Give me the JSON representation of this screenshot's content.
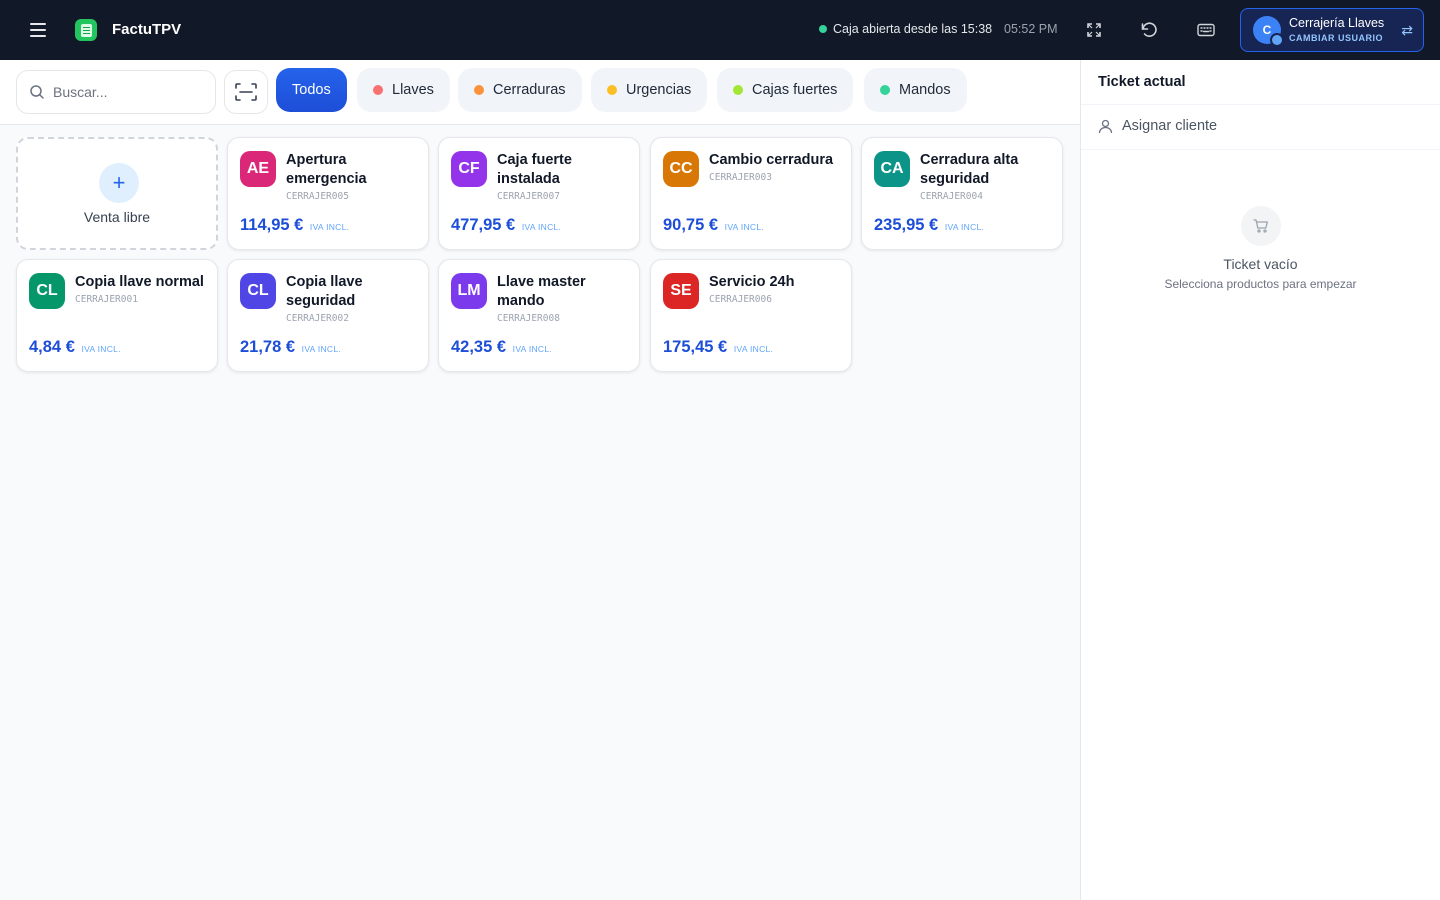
{
  "header": {
    "app_name": "FactuTPV",
    "status_text": "Caja abierta desde las 15:38",
    "time": "05:52 PM",
    "user": {
      "name": "Cerrajería Llaves",
      "avatar_initial": "C",
      "switch_label": "CAMBIAR USUARIO"
    },
    "icons": [
      "menu-icon",
      "logo-icon",
      "fullscreen-icon",
      "refresh-icon",
      "keyboard-icon",
      "swap-icon"
    ]
  },
  "search": {
    "placeholder": "Buscar..."
  },
  "categories": [
    {
      "label": "Todos",
      "active": true
    },
    {
      "label": "Llaves",
      "color": "#f87171"
    },
    {
      "label": "Cerraduras",
      "color": "#fb923c"
    },
    {
      "label": "Urgencias",
      "color": "#fbbf24"
    },
    {
      "label": "Cajas fuertes",
      "color": "#a3e635"
    },
    {
      "label": "Mandos",
      "color": "#34d399"
    }
  ],
  "free_sale": {
    "label": "Venta libre",
    "icon": "+"
  },
  "products": [
    {
      "initials": "AE",
      "name": "Apertura emergencia",
      "sku": "CERRAJER005",
      "price": "114,95 €",
      "iva": "IVA INCL.",
      "color": "#db2777"
    },
    {
      "initials": "CF",
      "name": "Caja fuerte instalada",
      "sku": "CERRAJER007",
      "price": "477,95 €",
      "iva": "IVA INCL.",
      "color": "#9333ea"
    },
    {
      "initials": "CC",
      "name": "Cambio cerradura",
      "sku": "CERRAJER003",
      "price": "90,75 €",
      "iva": "IVA INCL.",
      "color": "#d97706"
    },
    {
      "initials": "CA",
      "name": "Cerradura alta seguridad",
      "sku": "CERRAJER004",
      "price": "235,95 €",
      "iva": "IVA INCL.",
      "color": "#0d9488"
    },
    {
      "initials": "CL",
      "name": "Copia llave normal",
      "sku": "CERRAJER001",
      "price": "4,84 €",
      "iva": "IVA INCL.",
      "color": "#059669"
    },
    {
      "initials": "CL",
      "name": "Copia llave seguridad",
      "sku": "CERRAJER002",
      "price": "21,78 €",
      "iva": "IVA INCL.",
      "color": "#4f46e5"
    },
    {
      "initials": "LM",
      "name": "Llave master mando",
      "sku": "CERRAJER008",
      "price": "42,35 €",
      "iva": "IVA INCL.",
      "color": "#7c3aed"
    },
    {
      "initials": "SE",
      "name": "Servicio 24h",
      "sku": "CERRAJER006",
      "price": "175,45 €",
      "iva": "IVA INCL.",
      "color": "#dc2626"
    }
  ],
  "ticket": {
    "title": "Ticket actual",
    "assign_label": "Asignar cliente",
    "empty_title": "Ticket vacío",
    "empty_sub": "Selecciona productos para empezar"
  }
}
